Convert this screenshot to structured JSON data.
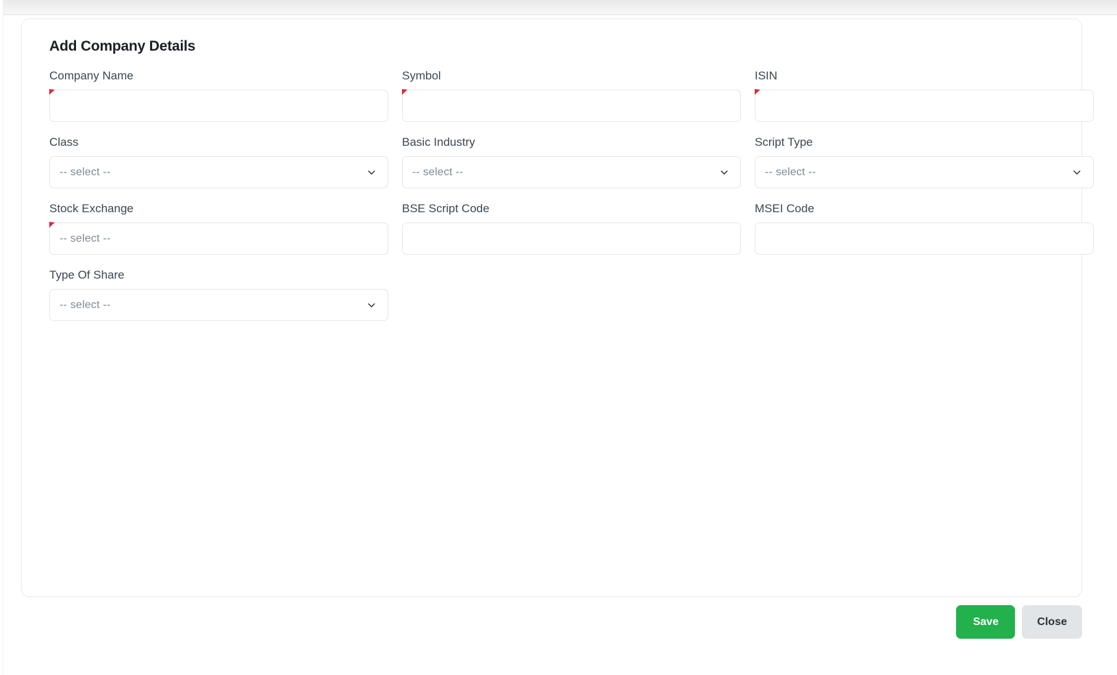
{
  "window": {
    "background_color": "#ffffff",
    "top_strip_color": "#eeeeee"
  },
  "card": {
    "title": "Add Company Details",
    "background_color": "#ffffff",
    "border_color": "#ececec"
  },
  "colors": {
    "required_marker": "#e0253c",
    "label_text": "#3c4652",
    "placeholder_text": "#7d8893",
    "save_button": "#22b14c",
    "close_button": "#e2e5e7"
  },
  "form": {
    "fields": [
      {
        "label": "Company Name",
        "type": "text",
        "value": "",
        "placeholder": "",
        "required": true,
        "name": "company-name"
      },
      {
        "label": "Symbol",
        "type": "text",
        "value": "",
        "placeholder": "",
        "required": true,
        "name": "symbol"
      },
      {
        "label": "ISIN",
        "type": "text",
        "value": "",
        "placeholder": "",
        "required": true,
        "name": "isin"
      },
      {
        "label": "Class",
        "type": "select",
        "value": "-- select --",
        "required": false,
        "name": "class"
      },
      {
        "label": "Basic Industry",
        "type": "select",
        "value": "-- select --",
        "required": false,
        "name": "basic-industry"
      },
      {
        "label": "Script Type",
        "type": "select",
        "value": "-- select --",
        "required": false,
        "name": "script-type"
      },
      {
        "label": "Stock Exchange",
        "type": "select-flat",
        "value": "-- select --",
        "required": true,
        "name": "stock-exchange"
      },
      {
        "label": "BSE Script Code",
        "type": "text",
        "value": "",
        "placeholder": "",
        "required": false,
        "name": "bse-script-code"
      },
      {
        "label": "MSEI Code",
        "type": "text",
        "value": "",
        "placeholder": "",
        "required": false,
        "name": "msei-code"
      },
      {
        "label": "Type Of Share",
        "type": "select",
        "value": "-- select --",
        "required": false,
        "name": "type-of-share"
      }
    ]
  },
  "footer": {
    "save_label": "Save",
    "close_label": "Close"
  },
  "icons": {
    "chevron_down": "chevron-down-icon",
    "required_flag": "required-marker-icon"
  }
}
